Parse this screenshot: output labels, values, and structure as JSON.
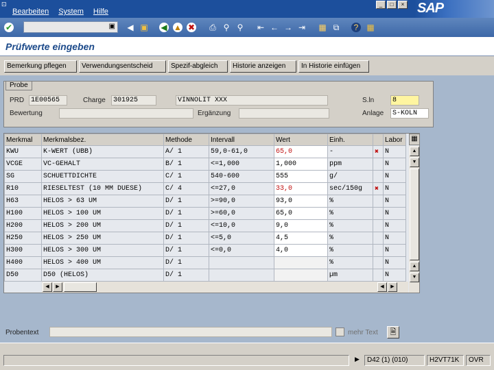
{
  "menu": {
    "items": [
      "Bearbeiten",
      "System",
      "Hilfe"
    ]
  },
  "toolbar": {
    "icons": [
      "enter-check-icon",
      "save-icon",
      "back-icon",
      "exit-icon",
      "cancel-icon",
      "print-icon",
      "find-icon",
      "find-next-icon",
      "first-page-icon",
      "prev-page-icon",
      "next-page-icon",
      "last-page-icon",
      "new-session-icon",
      "shortcut-icon",
      "help-icon",
      "layout-icon"
    ]
  },
  "title": "Prüfwerte eingeben",
  "app_buttons": [
    "Bemerkung pflegen",
    "Verwendungsentscheid",
    "Spezif-abgleich",
    "Historie anzeigen",
    "In Historie einfügen"
  ],
  "probe": {
    "legend": "Probe",
    "prd_label": "PRD",
    "prd_value": "1E00565",
    "charge_label": "Charge",
    "charge_value": "301925",
    "material_value": "VINNOLIT XXX",
    "sln_label": "S.ln",
    "sln_value": "8",
    "bewertung_label": "Bewertung",
    "ergaenzung_label": "Ergänzung",
    "anlage_label": "Anlage",
    "anlage_value": "S-KOLN"
  },
  "table": {
    "headers": [
      "Merkmal",
      "Merkmalsbez.",
      "Methode",
      "Intervall",
      "Wert",
      "Einh.",
      "",
      "Labor"
    ],
    "rows": [
      {
        "merkmal": "KWU",
        "bez": "K-WERT (UBB)",
        "methode": "A/ 1",
        "intervall": "59,0-61,0",
        "wert": "65,0",
        "einh": "-",
        "x": "✖",
        "labor": "N",
        "red": true
      },
      {
        "merkmal": "VCGE",
        "bez": "VC-GEHALT",
        "methode": "B/ 1",
        "intervall": "<=1,000",
        "wert": "1,000",
        "einh": "ppm",
        "x": "",
        "labor": "N",
        "red": false
      },
      {
        "merkmal": "SG",
        "bez": "SCHUETTDICHTE",
        "methode": "C/ 1",
        "intervall": "540-600",
        "wert": "555",
        "einh": "g/",
        "x": "",
        "labor": "N",
        "red": false
      },
      {
        "merkmal": "R10",
        "bez": "RIESELTEST (10 MM DUESE)",
        "methode": "C/ 4",
        "intervall": "<=27,0",
        "wert": "33,0",
        "einh": "sec/150g",
        "x": "✖",
        "labor": "N",
        "red": true
      },
      {
        "merkmal": "H63",
        "bez": "HELOS > 63 UM",
        "methode": "D/ 1",
        "intervall": ">=90,0",
        "wert": "93,0",
        "einh": "%",
        "x": "",
        "labor": "N",
        "red": false
      },
      {
        "merkmal": "H100",
        "bez": "HELOS > 100 UM",
        "methode": "D/ 1",
        "intervall": ">=60,0",
        "wert": "65,0",
        "einh": "%",
        "x": "",
        "labor": "N",
        "red": false
      },
      {
        "merkmal": "H200",
        "bez": "HELOS > 200 UM",
        "methode": "D/ 1",
        "intervall": "<=10,0",
        "wert": "9,0",
        "einh": "%",
        "x": "",
        "labor": "N",
        "red": false
      },
      {
        "merkmal": "H250",
        "bez": "HELOS > 250 UM",
        "methode": "D/ 1",
        "intervall": "<=5,0",
        "wert": "4,5",
        "einh": "%",
        "x": "",
        "labor": "N",
        "red": false
      },
      {
        "merkmal": "H300",
        "bez": "HELOS > 300 UM",
        "methode": "D/ 1",
        "intervall": "<=0,0",
        "wert": "4,0",
        "einh": "%",
        "x": "",
        "labor": "N",
        "red": false
      },
      {
        "merkmal": "H400",
        "bez": "HELOS > 400 UM",
        "methode": "D/ 1",
        "intervall": "",
        "wert": "",
        "einh": "%",
        "x": "",
        "labor": "N",
        "red": false
      },
      {
        "merkmal": "D50",
        "bez": "D50 (HELOS)",
        "methode": "D/ 1",
        "intervall": "",
        "wert": "",
        "einh": "µm",
        "x": "",
        "labor": "N",
        "red": false
      }
    ]
  },
  "probentext": {
    "label": "Probentext",
    "mehr_text": "mehr Text"
  },
  "status": {
    "session": "D42 (1) (010)",
    "server": "H2VT71K",
    "mode": "OVR"
  },
  "colors": {
    "sap_blue": "#1c4f9c",
    "area_bg": "#a6b7cc",
    "error_red": "#c01010",
    "highlight_yellow": "#fff5a0"
  }
}
